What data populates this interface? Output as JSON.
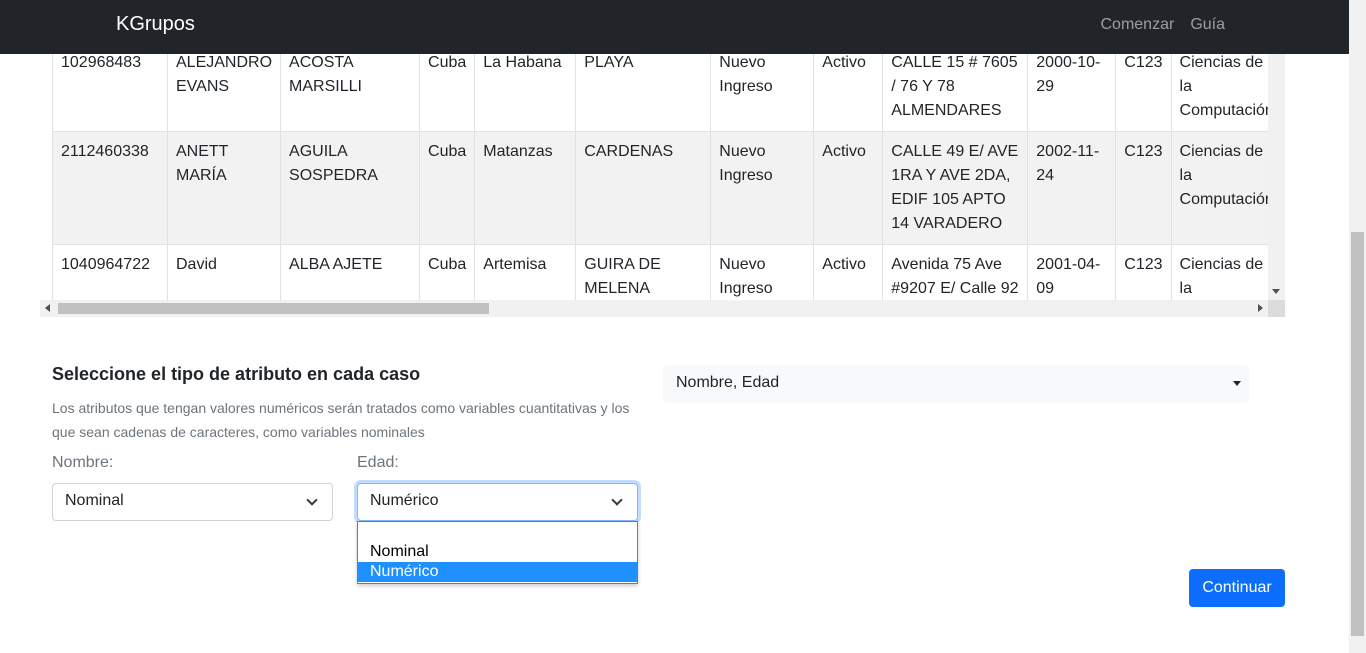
{
  "navbar": {
    "brand": "KGrupos",
    "links": [
      "Comenzar",
      "Guía"
    ]
  },
  "table": {
    "rows": [
      [
        "102968483",
        "ALEJANDRO EVANS",
        "ACOSTA MARSILLI",
        "Cuba",
        "La Habana",
        "PLAYA",
        "Nuevo Ingreso",
        "Activo",
        "CALLE 15 # 7605 / 76 Y 78 ALMENDARES",
        "2000-10-29",
        "C123",
        "Ciencias de la Computación"
      ],
      [
        "2112460338",
        "ANETT MARÍA",
        "AGUILA SOSPEDRA",
        "Cuba",
        "Matanzas",
        "CARDENAS",
        "Nuevo Ingreso",
        "Activo",
        "CALLE 49 E/ AVE 1RA Y AVE 2DA, EDIF 105 APTO 14 VARADERO",
        "2002-11-24",
        "C123",
        "Ciencias de la Computación"
      ],
      [
        "1040964722",
        "David",
        "ALBA AJETE",
        "Cuba",
        "Artemisa",
        "GUIRA DE MELENA",
        "Nuevo Ingreso",
        "Activo",
        "Avenida 75 Ave #9207 E/ Calle 92",
        "2001-04-09",
        "C123",
        "Ciencias de la"
      ]
    ]
  },
  "form": {
    "title": "Seleccione el tipo de atributo en cada caso",
    "description": "Los atributos que tengan valores numéricos serán tratados como variables cuantitativas y los que sean cadenas de caracteres, como variables nominales",
    "fields": [
      {
        "label": "Nombre:",
        "value": "Nominal"
      },
      {
        "label": "Edad:",
        "value": "Numérico"
      }
    ],
    "dropdown_options": [
      "Nominal",
      "Numérico"
    ],
    "attributes_selected": "Nombre, Edad",
    "continue_label": "Continuar"
  },
  "colors": {
    "navbar": "#212529",
    "primary": "#0d6efd",
    "option_highlight": "#1e90ff"
  }
}
